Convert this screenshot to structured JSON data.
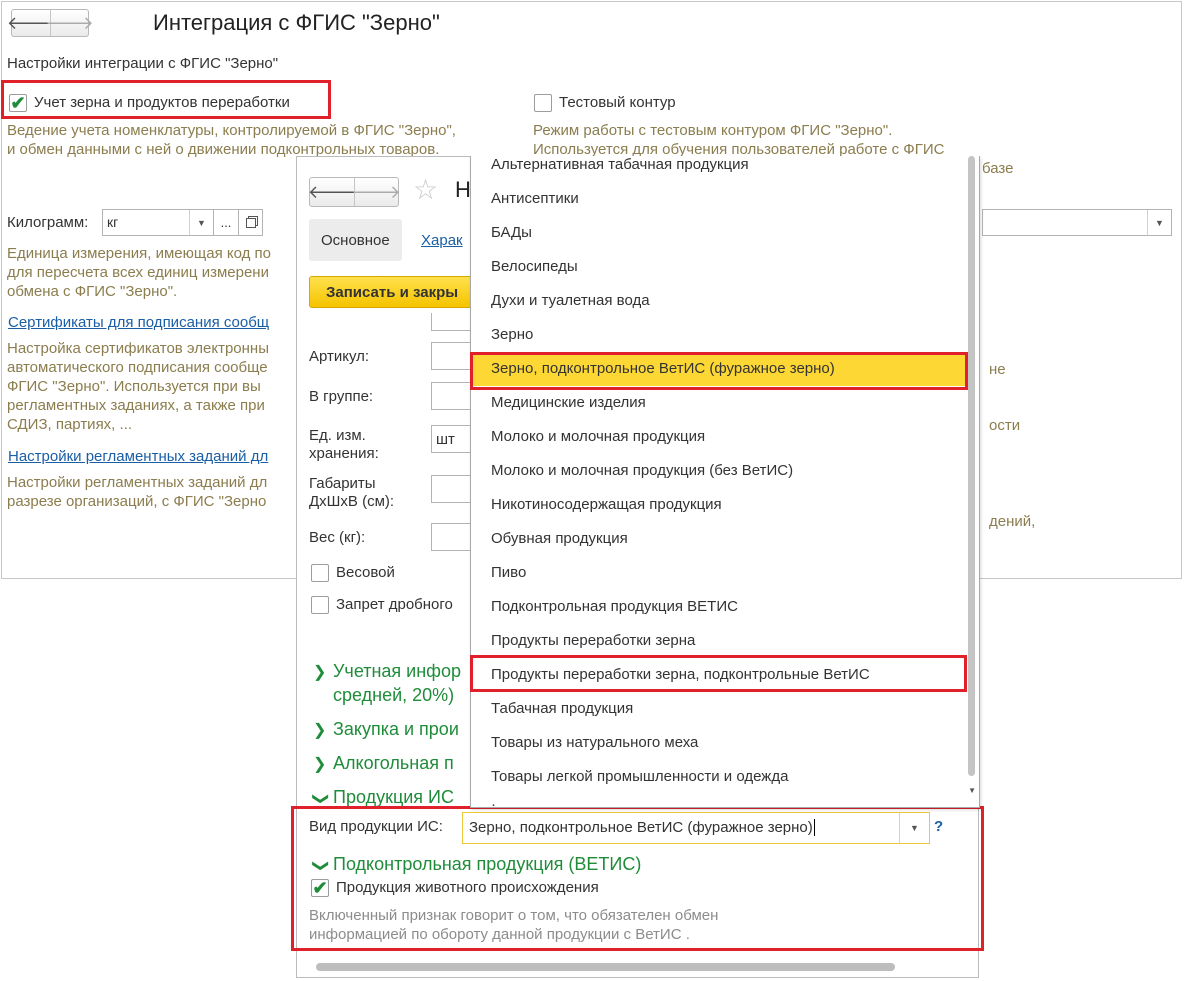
{
  "main": {
    "title": "Интеграция с ФГИС \"Зерно\"",
    "section_title": "Настройки интеграции с ФГИС \"Зерно\"",
    "grain_accounting": {
      "label": "Учет зерна и продуктов переработки",
      "checked": true,
      "desc1": "Ведение учета номенклатуры, контролируемой в ФГИС \"Зерно\",",
      "desc2": "и обмен данными с ней о движении подконтрольных товаров."
    },
    "test_contour": {
      "label": "Тестовый контур",
      "checked": false,
      "desc1": "Режим работы с тестовым контуром ФГИС \"Зерно\".",
      "desc2": "Используется для обучения пользователей работе с ФГИС",
      "desc3_tail": "базе"
    },
    "unit": {
      "label": "Килограмм:",
      "value": "кг",
      "ellipsis": "...",
      "desc1": "Единица измерения, имеющая код по",
      "desc2": "для пересчета всех единиц измерени",
      "desc3": "обмена с ФГИС \"Зерно\"."
    },
    "certs": {
      "link": "Сертификаты для подписания сообщ",
      "desc1": "Настройка сертификатов электронны",
      "desc2": "автоматического подписания сообще",
      "desc3": "ФГИС \"Зерно\". Используется при вы",
      "desc4": "регламентных заданиях, а также при",
      "desc5": "СДИЗ, партиях, ..."
    },
    "sched": {
      "link": "Настройки регламентных заданий дл",
      "desc1": "Настройки регламентных заданий дл",
      "desc2": "разрезе организаций, с ФГИС \"Зерно"
    },
    "right_fragments": {
      "ne": "не",
      "osti": "ости",
      "deniy": "дений,"
    }
  },
  "item": {
    "title_letter": "Н",
    "tabs": {
      "main": "Основное",
      "chars": "Харак"
    },
    "save_close": "Записать и закры",
    "fields": {
      "article": "Артикул:",
      "group": "В группе:",
      "unit_l1": "Ед. изм.",
      "unit_l2": "хранения:",
      "unit_value": "шт",
      "dims_l1": "Габариты",
      "dims_l2": "ДхШхВ (см):",
      "weight": "Вес (кг):"
    },
    "weighted": {
      "label": "Весовой",
      "checked": false
    },
    "fraction_ban": {
      "label": "Запрет дробного",
      "checked": false
    },
    "sections": {
      "accounting_l1": "Учетная инфор",
      "accounting_l2": "средней, 20%)",
      "purchase": "Закупка и прои",
      "alcohol": "Алкогольная п",
      "is_products": "Продукция ИС"
    },
    "is_kind": {
      "label": "Вид продукции ИС:",
      "value": "Зерно, подконтрольное  ВетИС (фуражное зерно)",
      "help": "?"
    },
    "vetis": {
      "title": "Подконтрольная продукция (ВЕТИС)",
      "animal_origin": {
        "label": "Продукция животного происхождения",
        "checked": true
      },
      "desc1": "Включенный признак говорит о том, что обязателен обмен",
      "desc2": "информацией по обороту данной продукции с ВетИС ."
    }
  },
  "dropdown": {
    "selected_index": 6,
    "highlighted_index": 15,
    "items": [
      "Альтернативная табачная продукция",
      "Антисептики",
      "БАДы",
      "Велосипеды",
      "Духи и туалетная вода",
      "Зерно",
      "Зерно, подконтрольное  ВетИС (фуражное зерно)",
      "Медицинские изделия",
      "Молоко и молочная продукция",
      "Молоко и молочная продукция (без ВетИС)",
      "Никотиносодержащая продукция",
      "Обувная продукция",
      "Пиво",
      "Подконтрольная продукция ВЕТИС",
      "Продукты переработки зерна",
      "Продукты переработки зерна, подконтрольные ВетИС",
      "Табачная продукция",
      "Товары из натурального меха",
      "Товары легкой промышленности и одежда"
    ]
  },
  "colors": {
    "accent_green": "#1f8c3a",
    "highlight_red": "#e0202b",
    "selected_yellow": "#fdd835",
    "link_blue": "#1a5ea6"
  }
}
